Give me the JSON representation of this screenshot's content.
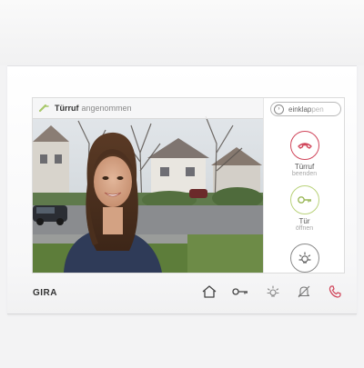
{
  "colors": {
    "accent_red": "#d0455a",
    "accent_green": "#b9d27a",
    "icon_gray": "#777777"
  },
  "status": {
    "icon": "door-call-icon",
    "title": "Türruf",
    "state": "angenommen"
  },
  "side_panel": {
    "collapse": {
      "icon": "chevron-right-icon",
      "label_main": "einklap",
      "label_faded": "pen"
    },
    "actions": [
      {
        "name": "end-call",
        "icon": "phone-hangup-icon",
        "line1": "Türruf",
        "line2": "beenden"
      },
      {
        "name": "open-door",
        "icon": "key-icon",
        "line1": "Tür",
        "line2": "öffnen"
      },
      {
        "name": "light",
        "icon": "light-icon",
        "line1": "",
        "line2": ""
      }
    ]
  },
  "device": {
    "brand": "GIRA",
    "buttons": [
      "home-icon",
      "key-icon",
      "light-icon",
      "mute-bell-icon",
      "phone-icon"
    ]
  }
}
